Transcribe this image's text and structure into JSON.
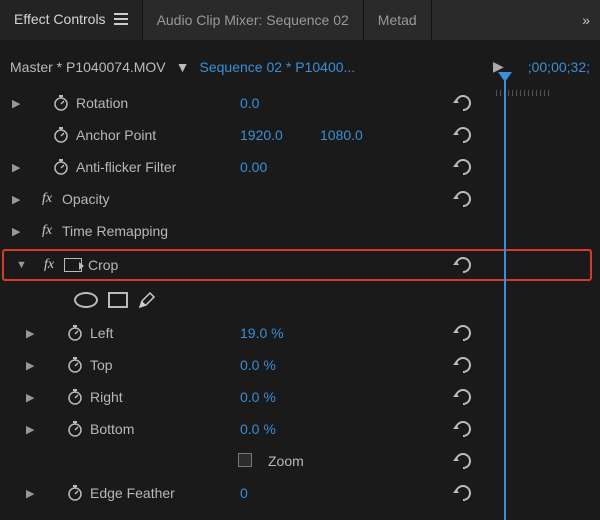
{
  "tabs": {
    "active": "Effect Controls",
    "t1": "Audio Clip Mixer: Sequence 02",
    "t2": "Metad",
    "overflow": "»"
  },
  "subheader": {
    "master": "Master * P1040074.MOV",
    "sequence": "Sequence 02 * P10400..."
  },
  "timecode": ";00;00;32;",
  "rows": {
    "rotation": {
      "label": "Rotation",
      "value": "0.0"
    },
    "anchor": {
      "label": "Anchor Point",
      "x": "1920.0",
      "y": "1080.0"
    },
    "antiflicker": {
      "label": "Anti-flicker Filter",
      "value": "0.00"
    },
    "opacity": {
      "label": "Opacity"
    },
    "timeremap": {
      "label": "Time Remapping"
    },
    "crop": {
      "label": "Crop"
    },
    "left": {
      "label": "Left",
      "value": "19.0 %"
    },
    "top": {
      "label": "Top",
      "value": "0.0 %"
    },
    "right": {
      "label": "Right",
      "value": "0.0 %"
    },
    "bottom": {
      "label": "Bottom",
      "value": "0.0 %"
    },
    "zoom": {
      "label": "Zoom"
    },
    "edgefeather": {
      "label": "Edge Feather",
      "value": "0"
    }
  }
}
